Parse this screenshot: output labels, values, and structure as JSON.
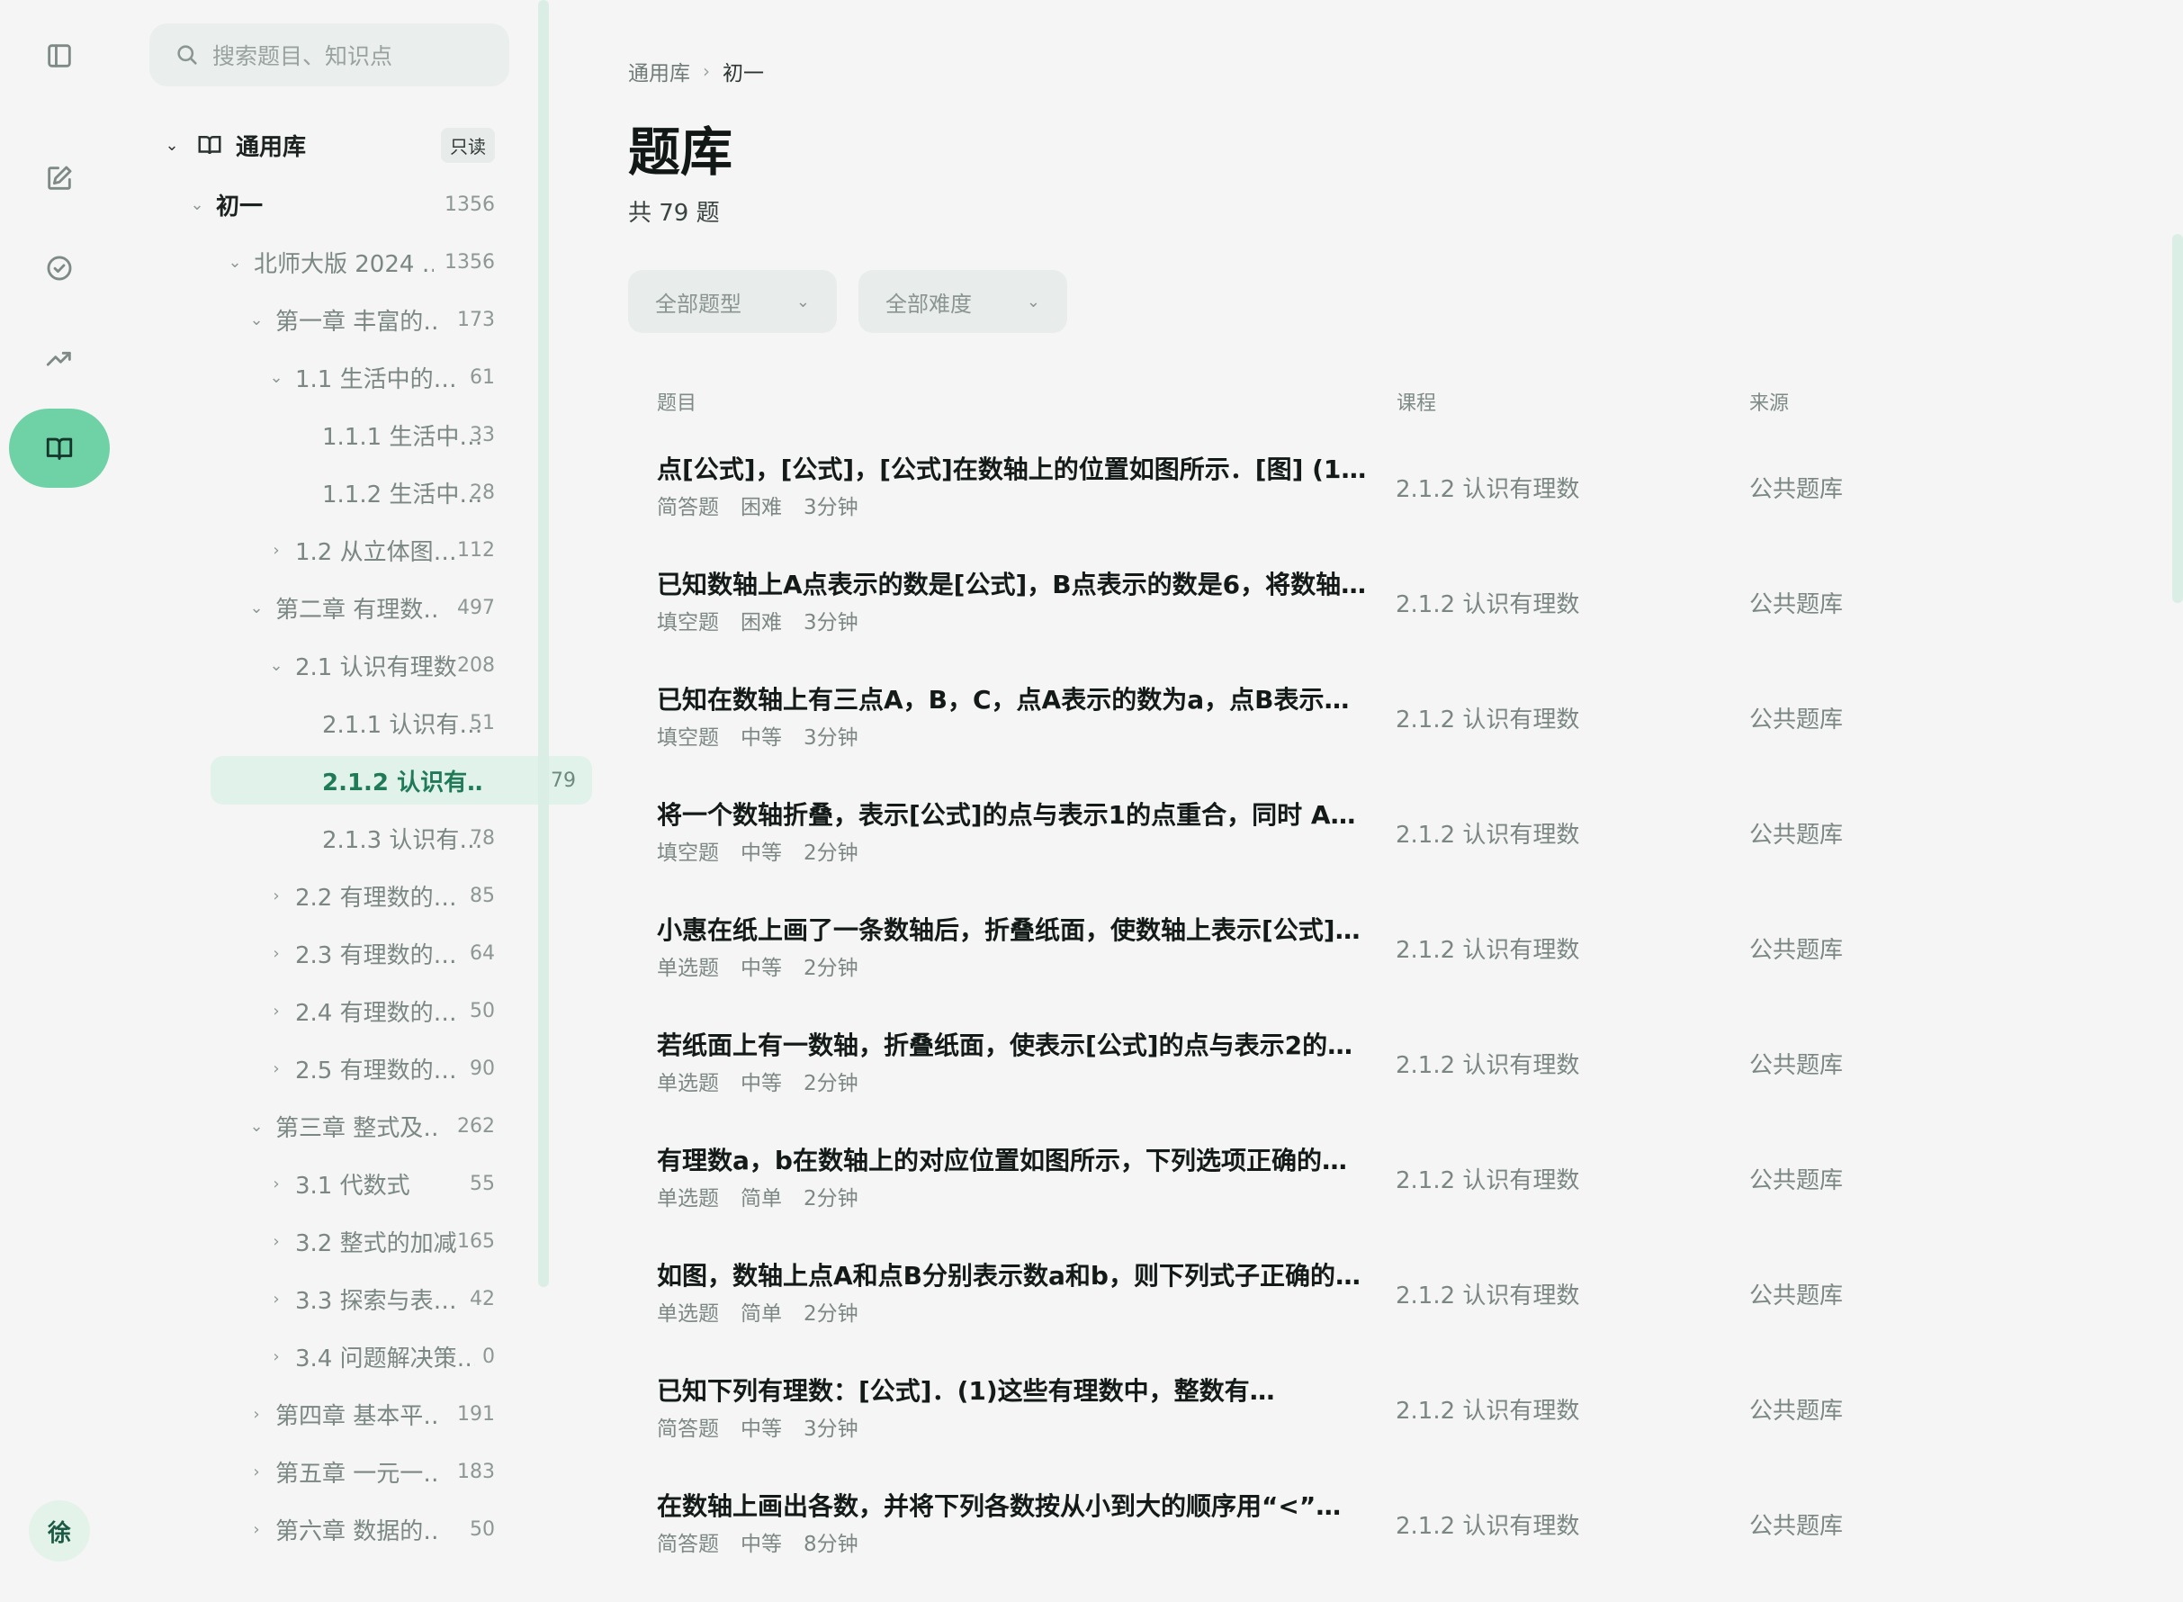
{
  "search": {
    "placeholder": "搜索题目、知识点"
  },
  "rail": [
    "sidebar-toggle-icon",
    "edit-icon",
    "check-circle-icon",
    "trending-up-icon",
    "book-open-icon"
  ],
  "user": {
    "avatar": "徐"
  },
  "tree": {
    "root": {
      "label": "通用库",
      "badge": "只读"
    },
    "items": [
      {
        "label": "初一",
        "count": "1356"
      },
      {
        "label": "北师大版 2024 …",
        "count": "1356"
      },
      {
        "label": "第一章 丰富的…",
        "count": "173"
      },
      {
        "label": "1.1 生活中的…",
        "count": "61"
      },
      {
        "label": "1.1.1 生活中…",
        "count": "33"
      },
      {
        "label": "1.1.2 生活中…",
        "count": "28"
      },
      {
        "label": "1.2 从立体图…",
        "count": "112"
      },
      {
        "label": "第二章 有理数…",
        "count": "497"
      },
      {
        "label": "2.1 认识有理数",
        "count": "208"
      },
      {
        "label": "2.1.1 认识有…",
        "count": "51"
      },
      {
        "label": "2.1.2 认识有…",
        "count": "79"
      },
      {
        "label": "2.1.3 认识有…",
        "count": "78"
      },
      {
        "label": "2.2 有理数的…",
        "count": "85"
      },
      {
        "label": "2.3 有理数的…",
        "count": "64"
      },
      {
        "label": "2.4 有理数的…",
        "count": "50"
      },
      {
        "label": "2.5 有理数的…",
        "count": "90"
      },
      {
        "label": "第三章 整式及…",
        "count": "262"
      },
      {
        "label": "3.1 代数式",
        "count": "55"
      },
      {
        "label": "3.2 整式的加减",
        "count": "165"
      },
      {
        "label": "3.3 探索与表…",
        "count": "42"
      },
      {
        "label": "3.4 问题解决策…",
        "count": "0"
      },
      {
        "label": "第四章 基本平…",
        "count": "191"
      },
      {
        "label": "第五章 一元一…",
        "count": "183"
      },
      {
        "label": "第六章 数据的…",
        "count": "50"
      }
    ]
  },
  "breadcrumb": {
    "parent": "通用库",
    "current": "初一"
  },
  "page": {
    "title": "题库",
    "total": "共 79 题"
  },
  "filters": {
    "type": "全部题型",
    "difficulty": "全部难度"
  },
  "table": {
    "headers": {
      "question": "题目",
      "course": "课程",
      "source": "来源"
    },
    "rows": [
      {
        "title": "点[公式]，[公式]，[公式]在数轴上的位置如图所示．[图] (1)…",
        "type": "简答题",
        "difficulty": "困难",
        "time": "3分钟",
        "course": "2.1.2 认识有理数",
        "source": "公共题库"
      },
      {
        "title": "已知数轴上A点表示的数是[公式]，B点表示的数是6，将数轴…",
        "type": "填空题",
        "difficulty": "困难",
        "time": "3分钟",
        "course": "2.1.2 认识有理数",
        "source": "公共题库"
      },
      {
        "title": "已知在数轴上有三点A，B，C，点A表示的数为a，点B表示的…",
        "type": "填空题",
        "difficulty": "中等",
        "time": "3分钟",
        "course": "2.1.2 认识有理数",
        "source": "公共题库"
      },
      {
        "title": "将一个数轴折叠，表示[公式]的点与表示1的点重合，同时 A…",
        "type": "填空题",
        "difficulty": "中等",
        "time": "2分钟",
        "course": "2.1.2 认识有理数",
        "source": "公共题库"
      },
      {
        "title": "小惠在纸上画了一条数轴后，折叠纸面，使数轴上表示[公式]…",
        "type": "单选题",
        "difficulty": "中等",
        "time": "2分钟",
        "course": "2.1.2 认识有理数",
        "source": "公共题库"
      },
      {
        "title": "若纸面上有一数轴，折叠纸面，使表示[公式]的点与表示2的…",
        "type": "单选题",
        "difficulty": "中等",
        "time": "2分钟",
        "course": "2.1.2 认识有理数",
        "source": "公共题库"
      },
      {
        "title": "有理数a，b在数轴上的对应位置如图所示，下列选项正确的…",
        "type": "单选题",
        "difficulty": "简单",
        "time": "2分钟",
        "course": "2.1.2 认识有理数",
        "source": "公共题库"
      },
      {
        "title": "如图，数轴上点A和点B分别表示数a和b，则下列式子正确的…",
        "type": "单选题",
        "difficulty": "简单",
        "time": "2分钟",
        "course": "2.1.2 认识有理数",
        "source": "公共题库"
      },
      {
        "title": "已知下列有理数：[公式]．(1)这些有理数中，整数有…",
        "type": "简答题",
        "difficulty": "中等",
        "time": "3分钟",
        "course": "2.1.2 认识有理数",
        "source": "公共题库"
      },
      {
        "title": "在数轴上画出各数，并将下列各数按从小到大的顺序用“<”…",
        "type": "简答题",
        "difficulty": "中等",
        "time": "8分钟",
        "course": "2.1.2 认识有理数",
        "source": "公共题库"
      }
    ]
  }
}
